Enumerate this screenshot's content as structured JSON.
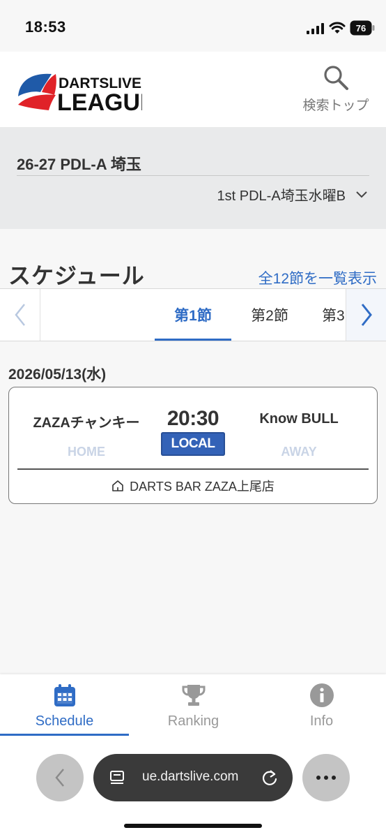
{
  "status_bar": {
    "time": "18:53",
    "battery": "76"
  },
  "header": {
    "logo_top": "DARTSLIVE",
    "logo_bottom": "LEAGUE",
    "search_label": "検索トップ"
  },
  "league": {
    "title": "26-27 PDL-A 埼玉",
    "division": "1st PDL-A埼玉水曜B"
  },
  "schedule": {
    "heading": "スケジュール",
    "show_all_link": "全12節を一覧表示",
    "tabs": [
      {
        "label": "第1節",
        "active": true
      },
      {
        "label": "第2節",
        "active": false
      },
      {
        "label": "第3",
        "active": false
      }
    ]
  },
  "match": {
    "date": "2026/05/13(水)",
    "home_team": "ZAZAチャンキー",
    "away_team": "Know BULL",
    "time": "20:30",
    "badge": "LOCAL",
    "home_label": "HOME",
    "away_label": "AWAY",
    "venue": "DARTS BAR ZAZA上尾店"
  },
  "bottom_nav": [
    {
      "label": "Schedule",
      "icon": "calendar-icon",
      "active": true
    },
    {
      "label": "Ranking",
      "icon": "trophy-icon",
      "active": false
    },
    {
      "label": "Info",
      "icon": "info-icon",
      "active": false
    }
  ],
  "browser": {
    "url": "ue.dartslive.com"
  },
  "colors": {
    "accent": "#2f6cc5",
    "badge": "#3362b7",
    "panel": "#e9eaeb",
    "logo_red": "#e02228",
    "logo_blue": "#1f5aa8"
  }
}
